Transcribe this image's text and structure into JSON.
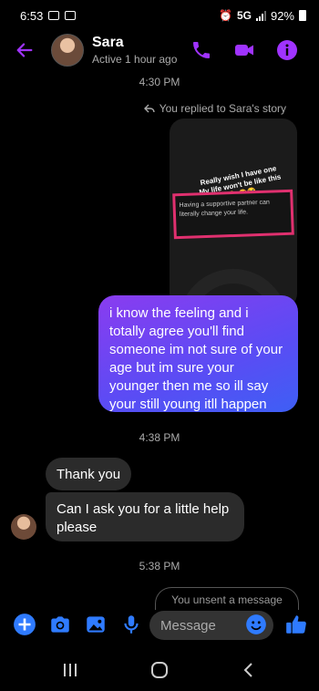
{
  "status_bar": {
    "time": "6:53",
    "network": "5G",
    "battery": "92%"
  },
  "header": {
    "name": "Sara",
    "status": "Active 1 hour ago"
  },
  "conversation": {
    "time_1": "4:30 PM",
    "reply_note": "You replied to Sara's story",
    "story": {
      "caption": "Really wish I have one My life won't be like this😭 😭😭",
      "quote": "Having a supportive partner can literally change your life."
    },
    "sent_message": "i know the feeling and i totally agree you'll find someone im not sure of your age but im sure your younger then me so ill say your still young  itll happen",
    "time_2": "4:38 PM",
    "received_1": "Thank you",
    "received_2": "Can I ask you for a little help please",
    "time_3": "5:38 PM",
    "unsent_peek": "You unsent a message"
  },
  "composer": {
    "placeholder": "Message"
  },
  "colors": {
    "accent": "#a033ff",
    "blue": "#2f7bff"
  }
}
